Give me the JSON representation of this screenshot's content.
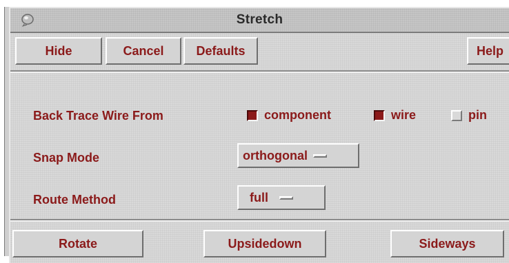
{
  "window": {
    "title": "Stretch"
  },
  "toolbar": {
    "hide_label": "Hide",
    "cancel_label": "Cancel",
    "defaults_label": "Defaults",
    "help_label": "Help"
  },
  "back_trace": {
    "label": "Back Trace Wire From",
    "options": [
      {
        "label": "component",
        "checked": true
      },
      {
        "label": "wire",
        "checked": true
      },
      {
        "label": "pin",
        "checked": false
      }
    ]
  },
  "snap_mode": {
    "label": "Snap Mode",
    "value": "orthogonal"
  },
  "route_method": {
    "label": "Route Method",
    "value": "full"
  },
  "actions": {
    "rotate_label": "Rotate",
    "upsidedown_label": "Upsidedown",
    "sideways_label": "Sideways"
  },
  "colors": {
    "accent": "#8b1a1a",
    "background": "#d9d9d9"
  },
  "icons": {
    "window_menu": "window-menu-icon"
  }
}
